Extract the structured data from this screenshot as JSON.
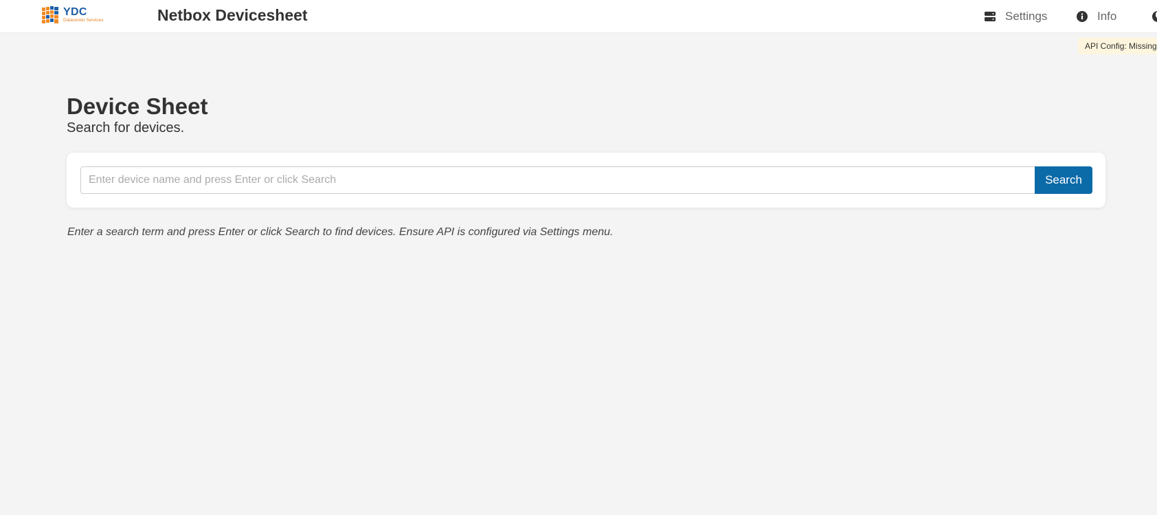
{
  "header": {
    "logo": {
      "name": "YDC",
      "tagline": "Datacenter Services",
      "colors": {
        "grid_orange": "#f08a24",
        "grid_blue": "#1f5fa6"
      }
    },
    "title": "Netbox Devicesheet",
    "nav": [
      {
        "label": "Settings",
        "icon": "server-icon"
      },
      {
        "label": "Info",
        "icon": "info-icon"
      }
    ],
    "theme_toggle_icon": "moon-icon"
  },
  "status_badge": {
    "text": "API Config: Missing",
    "color": "#fdf5dd"
  },
  "main": {
    "title": "Device Sheet",
    "subtitle": "Search for devices.",
    "search": {
      "placeholder": "Enter device name and press Enter or click Search",
      "value": "",
      "button_label": "Search",
      "button_color": "#0b6aa8"
    },
    "help_text": "Enter a search term and press Enter or click Search to find devices. Ensure API is configured via Settings menu."
  }
}
